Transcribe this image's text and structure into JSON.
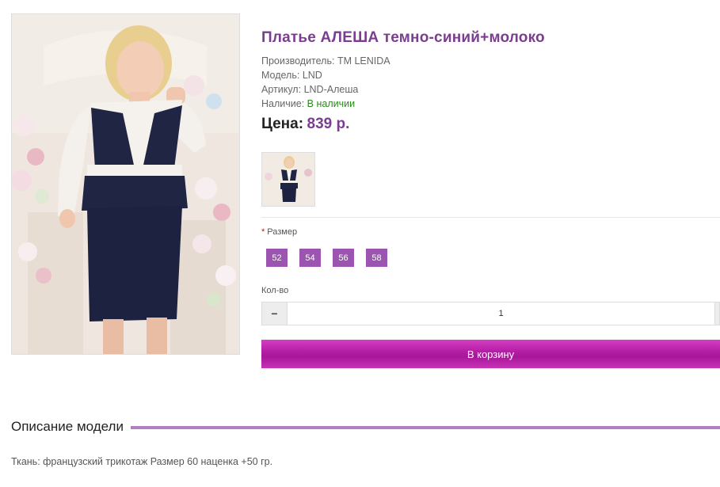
{
  "product": {
    "title": "Платье АЛЕША темно-синий+молоко",
    "manufacturer_label": "Производитель:",
    "manufacturer_value": "TM LENIDA",
    "model_label": "Модель:",
    "model_value": "LND",
    "sku_label": "Артикул:",
    "sku_value": "LND-Алеша",
    "availability_label": "Наличие:",
    "availability_value": "В наличии",
    "price_label": "Цена:",
    "price_value": "839 р."
  },
  "options": {
    "size_required_mark": "*",
    "size_label": "Размер",
    "sizes": [
      "52",
      "54",
      "56",
      "58"
    ]
  },
  "quantity": {
    "label": "Кол-во",
    "minus": "−",
    "value": "1"
  },
  "cart": {
    "button_label": "В корзину"
  },
  "description": {
    "heading": "Описание модели",
    "text": "Ткань: французский трикотаж Размер 60 наценка +50 гр."
  },
  "colors": {
    "accent": "#7b3d8f",
    "size_button": "#9b55b0",
    "cart_button": "#b41fa5",
    "in_stock": "#2a8a1a",
    "divider": "#b07fc0"
  }
}
